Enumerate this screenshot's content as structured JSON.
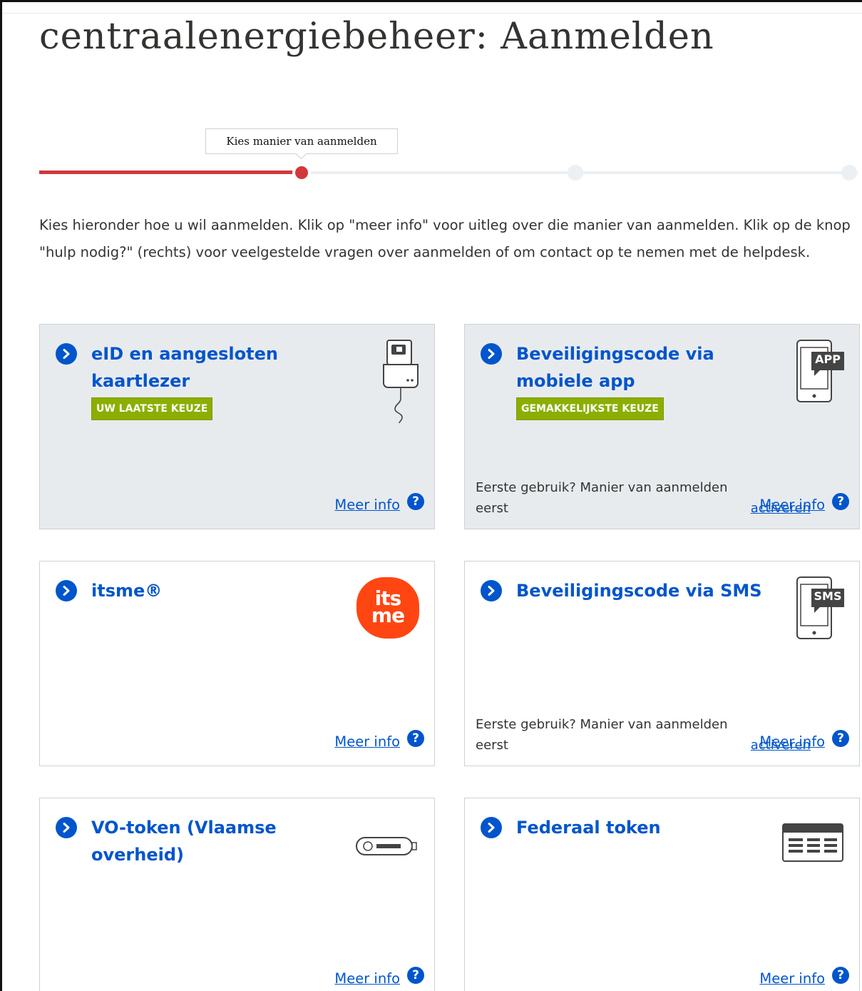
{
  "page": {
    "title": "centraalenergiebeheer: Aanmelden"
  },
  "progress": {
    "tooltip": "Kies manier van aanmelden",
    "current_step": 1,
    "total_steps": 3
  },
  "intro": "Kies hieronder hoe u wil aanmelden. Klik op \"meer info\" voor uitleg over die manier van aanmelden. Klik op de knop \"hulp nodig?\" (rechts) voor veelgestelde vragen over aanmelden of om contact op te nemen met de helpdesk.",
  "common": {
    "meer_info": "Meer info",
    "help_symbol": "?",
    "first_use_text": "Eerste gebruik? Manier van aanmelden eerst",
    "activate_link": "activeren"
  },
  "cards": [
    {
      "title": "eID en aangesloten kaartlezer",
      "badge": "UW LAATSTE KEUZE",
      "icon": "card-reader-icon",
      "highlighted": true
    },
    {
      "title": "Beveiligingscode via mobiele app",
      "badge": "GEMAKKELIJKSTE KEUZE",
      "icon": "phone-app-icon",
      "icon_label": "APP",
      "highlighted": true
    },
    {
      "title": "itsme®",
      "icon": "itsme-logo"
    },
    {
      "title": "Beveiligingscode via SMS",
      "icon": "phone-sms-icon",
      "icon_label": "SMS"
    },
    {
      "title": "VO-token (Vlaamse overheid)",
      "icon": "usb-token-icon"
    },
    {
      "title": "Federaal token",
      "icon": "token-card-icon"
    }
  ],
  "itsme_logo_text": {
    "line1": "its",
    "line2": "me"
  },
  "colors": {
    "primary": "#0055cc",
    "accent": "#d2373c",
    "badge": "#8bae00",
    "highlight_bg": "#e8ebee",
    "itsme": "#ff4612"
  }
}
